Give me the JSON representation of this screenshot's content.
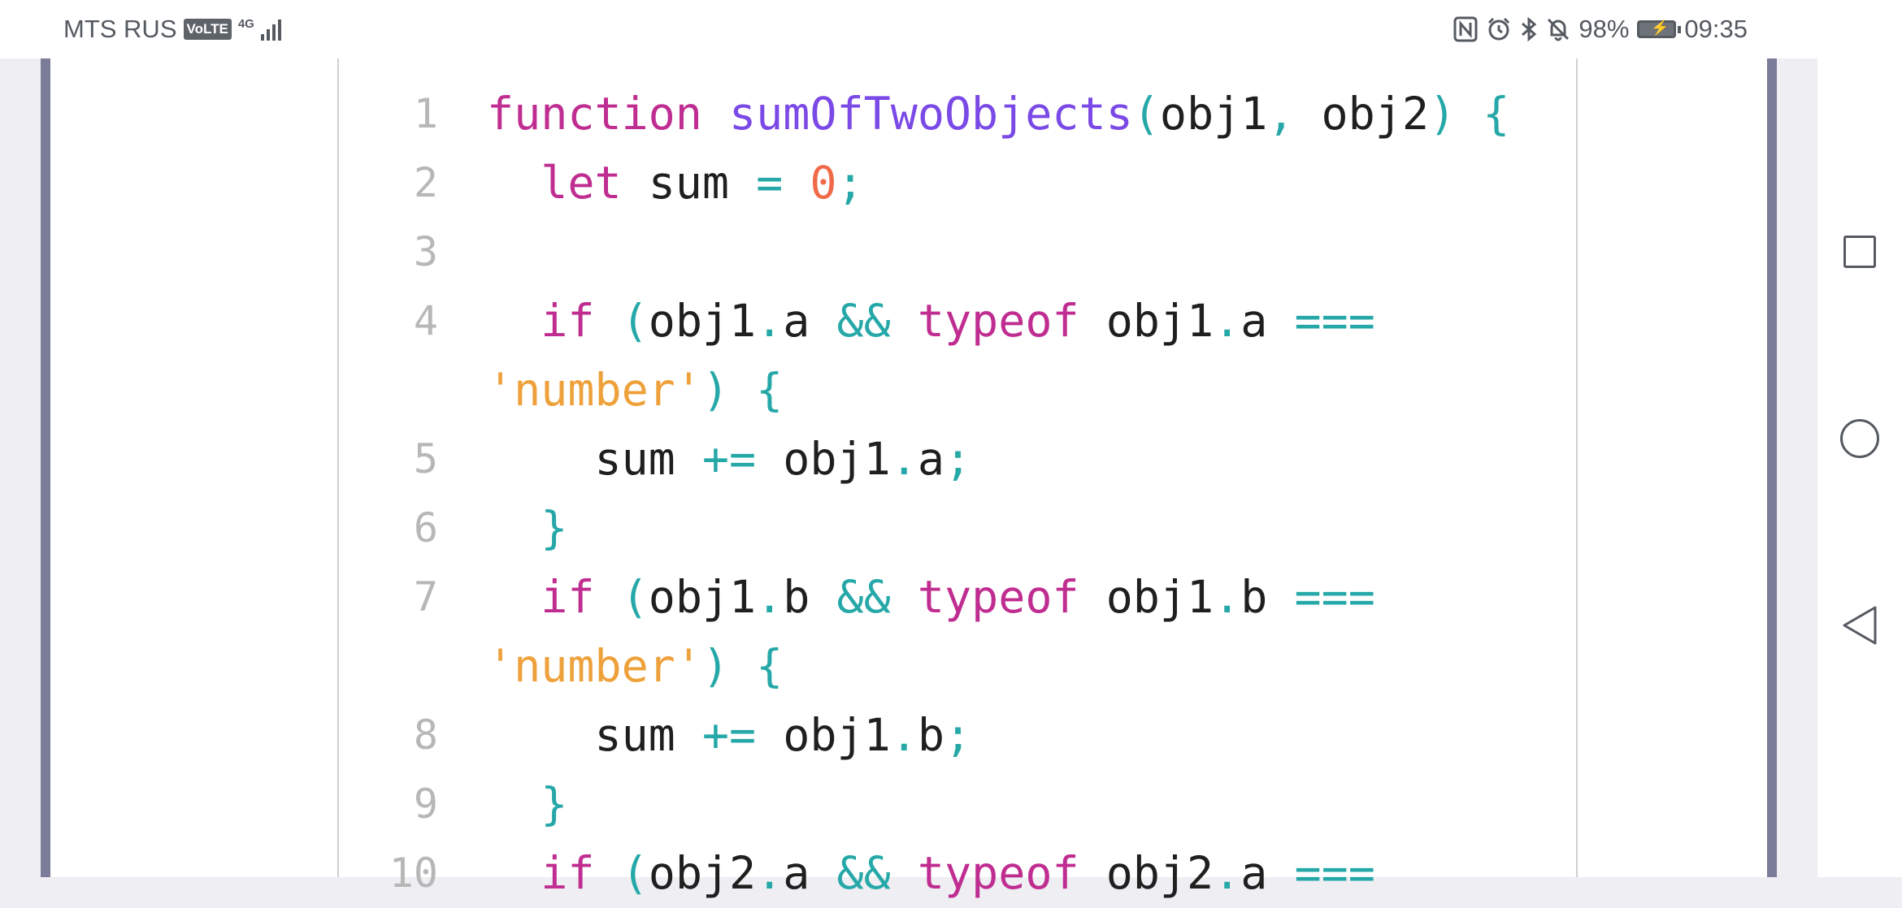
{
  "status_bar": {
    "carrier": "MTS RUS",
    "volte": "VoLTE",
    "network": "4G",
    "battery_percent": "98%",
    "time": "09:35",
    "icons": [
      "nfc-icon",
      "alarm-icon",
      "bluetooth-icon",
      "mute-icon",
      "battery-icon"
    ]
  },
  "code": {
    "line_numbers": [
      "1",
      "2",
      "3",
      "4",
      "5",
      "6",
      "7",
      "8",
      "9",
      "10"
    ],
    "colors": {
      "keyword": "#c02d91",
      "function_name": "#7a49e6",
      "operator": "#27a8a8",
      "number": "#f06a4a",
      "string": "#eea13a",
      "identifier": "#1f1f1f",
      "line_number": "#b7b7b7"
    },
    "lines": [
      [
        {
          "t": "function",
          "c": "kw"
        },
        {
          "t": " ",
          "c": "id"
        },
        {
          "t": "sumOfTwoObjects",
          "c": "fn"
        },
        {
          "t": "(",
          "c": "op"
        },
        {
          "t": "obj1",
          "c": "id"
        },
        {
          "t": ",",
          "c": "op"
        },
        {
          "t": " obj2",
          "c": "id"
        },
        {
          "t": ")",
          "c": "op"
        },
        {
          "t": " ",
          "c": "id"
        },
        {
          "t": "{",
          "c": "op"
        }
      ],
      [
        {
          "t": "  ",
          "c": "id"
        },
        {
          "t": "let",
          "c": "kw"
        },
        {
          "t": " sum ",
          "c": "id"
        },
        {
          "t": "=",
          "c": "op"
        },
        {
          "t": " ",
          "c": "id"
        },
        {
          "t": "0",
          "c": "num"
        },
        {
          "t": ";",
          "c": "op"
        }
      ],
      [],
      [
        {
          "t": "  ",
          "c": "id"
        },
        {
          "t": "if",
          "c": "kw"
        },
        {
          "t": " ",
          "c": "id"
        },
        {
          "t": "(",
          "c": "op"
        },
        {
          "t": "obj1",
          "c": "id"
        },
        {
          "t": ".",
          "c": "op"
        },
        {
          "t": "a ",
          "c": "id"
        },
        {
          "t": "&&",
          "c": "op"
        },
        {
          "t": " ",
          "c": "id"
        },
        {
          "t": "typeof",
          "c": "kw"
        },
        {
          "t": " obj1",
          "c": "id"
        },
        {
          "t": ".",
          "c": "op"
        },
        {
          "t": "a ",
          "c": "id"
        },
        {
          "t": "===",
          "c": "op"
        }
      ],
      [
        {
          "t": "'number'",
          "c": "str"
        },
        {
          "t": ")",
          "c": "op"
        },
        {
          "t": " ",
          "c": "id"
        },
        {
          "t": "{",
          "c": "op"
        }
      ],
      [
        {
          "t": "    sum ",
          "c": "id"
        },
        {
          "t": "+=",
          "c": "op"
        },
        {
          "t": " obj1",
          "c": "id"
        },
        {
          "t": ".",
          "c": "op"
        },
        {
          "t": "a",
          "c": "id"
        },
        {
          "t": ";",
          "c": "op"
        }
      ],
      [
        {
          "t": "  ",
          "c": "id"
        },
        {
          "t": "}",
          "c": "op"
        }
      ],
      [
        {
          "t": "  ",
          "c": "id"
        },
        {
          "t": "if",
          "c": "kw"
        },
        {
          "t": " ",
          "c": "id"
        },
        {
          "t": "(",
          "c": "op"
        },
        {
          "t": "obj1",
          "c": "id"
        },
        {
          "t": ".",
          "c": "op"
        },
        {
          "t": "b ",
          "c": "id"
        },
        {
          "t": "&&",
          "c": "op"
        },
        {
          "t": " ",
          "c": "id"
        },
        {
          "t": "typeof",
          "c": "kw"
        },
        {
          "t": " obj1",
          "c": "id"
        },
        {
          "t": ".",
          "c": "op"
        },
        {
          "t": "b ",
          "c": "id"
        },
        {
          "t": "===",
          "c": "op"
        }
      ],
      [
        {
          "t": "'number'",
          "c": "str"
        },
        {
          "t": ")",
          "c": "op"
        },
        {
          "t": " ",
          "c": "id"
        },
        {
          "t": "{",
          "c": "op"
        }
      ],
      [
        {
          "t": "    sum ",
          "c": "id"
        },
        {
          "t": "+=",
          "c": "op"
        },
        {
          "t": " obj1",
          "c": "id"
        },
        {
          "t": ".",
          "c": "op"
        },
        {
          "t": "b",
          "c": "id"
        },
        {
          "t": ";",
          "c": "op"
        }
      ],
      [
        {
          "t": "  ",
          "c": "id"
        },
        {
          "t": "}",
          "c": "op"
        }
      ],
      [
        {
          "t": "  ",
          "c": "id"
        },
        {
          "t": "if",
          "c": "kw"
        },
        {
          "t": " ",
          "c": "id"
        },
        {
          "t": "(",
          "c": "op"
        },
        {
          "t": "obj2",
          "c": "id"
        },
        {
          "t": ".",
          "c": "op"
        },
        {
          "t": "a ",
          "c": "id"
        },
        {
          "t": "&&",
          "c": "op"
        },
        {
          "t": " ",
          "c": "id"
        },
        {
          "t": "typeof",
          "c": "kw"
        },
        {
          "t": " obj2",
          "c": "id"
        },
        {
          "t": ".",
          "c": "op"
        },
        {
          "t": "a ",
          "c": "id"
        },
        {
          "t": "===",
          "c": "op"
        }
      ]
    ],
    "line_number_map": [
      "1",
      "2",
      "3",
      "4",
      "",
      "5",
      "6",
      "7",
      "",
      "8",
      "9",
      "10"
    ]
  },
  "nav_bar": {
    "buttons": [
      "recents-button",
      "home-button",
      "back-button"
    ]
  }
}
